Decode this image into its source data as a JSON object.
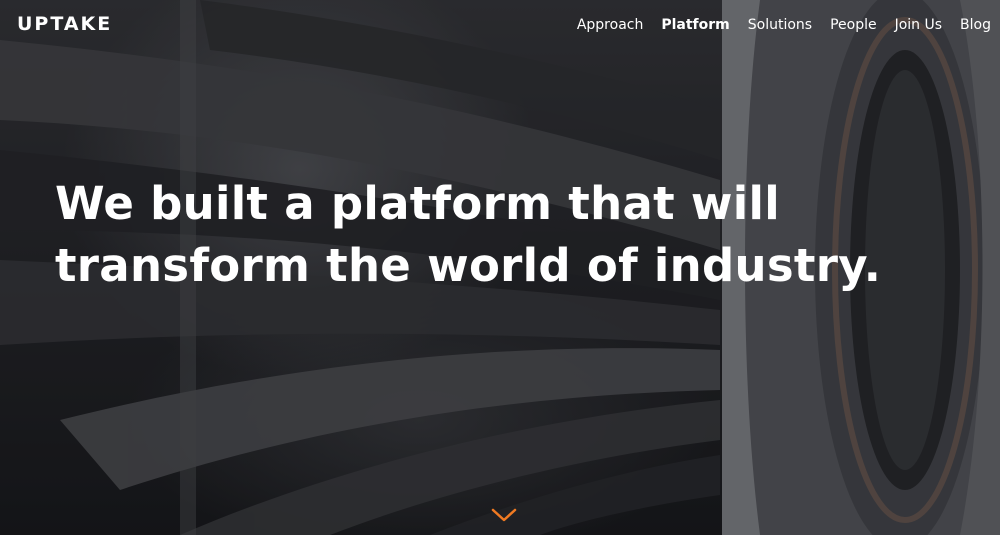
{
  "brand": {
    "logo_text": "UPTAKE"
  },
  "nav": {
    "items": [
      {
        "label": "Approach",
        "active": false
      },
      {
        "label": "Platform",
        "active": true
      },
      {
        "label": "Solutions",
        "active": false
      },
      {
        "label": "People",
        "active": false
      },
      {
        "label": "Join Us",
        "active": false
      },
      {
        "label": "Blog",
        "active": false
      }
    ]
  },
  "hero": {
    "headline_line1": "We built a platform that will",
    "headline_line2": "transform the world of industry.",
    "scroll_icon": "chevron-down-icon",
    "accent_color": "#f07a22"
  }
}
